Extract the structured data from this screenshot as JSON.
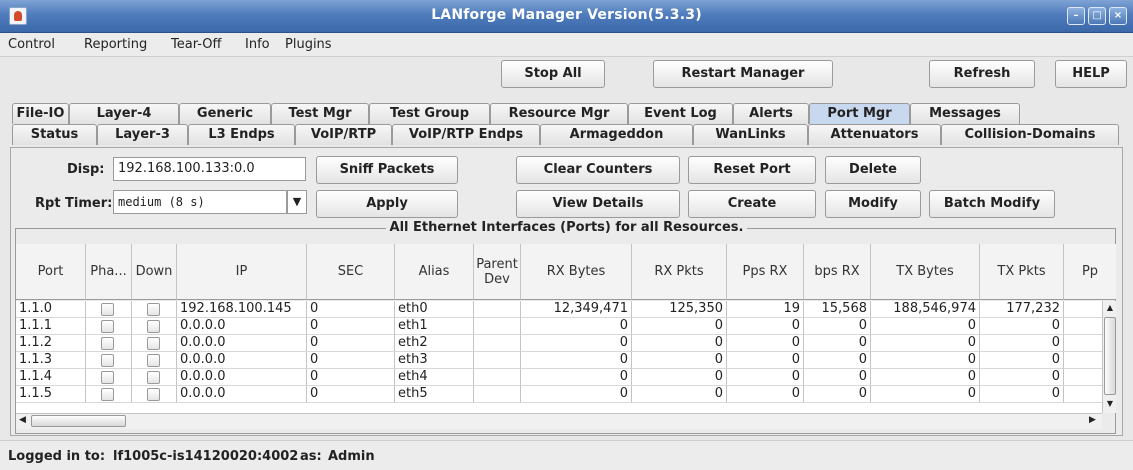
{
  "window": {
    "title": "LANforge Manager   Version(5.3.3)",
    "controls": [
      "minimize-icon",
      "maximize-icon",
      "close-icon"
    ]
  },
  "menu": [
    "Control",
    "Reporting",
    "Tear-Off",
    "Info",
    "Plugins"
  ],
  "toolbar": {
    "stop_all": "Stop All",
    "restart_manager": "Restart Manager",
    "refresh": "Refresh",
    "help": "HELP"
  },
  "tabs_row1": [
    "File-IO",
    "Layer-4",
    "Generic",
    "Test Mgr",
    "Test Group",
    "Resource Mgr",
    "Event Log",
    "Alerts",
    "Port Mgr",
    "Messages"
  ],
  "tabs_row2": [
    "Status",
    "Layer-3",
    "L3 Endps",
    "VoIP/RTP",
    "VoIP/RTP Endps",
    "Armageddon",
    "WanLinks",
    "Attenuators",
    "Collision-Domains"
  ],
  "active_tab": "Port Mgr",
  "controls": {
    "disp_label": "Disp:",
    "disp_value": "192.168.100.133:0.0",
    "rpt_timer_label": "Rpt Timer:",
    "rpt_timer_value": "medium   (8 s)",
    "sniff_packets": "Sniff Packets",
    "apply": "Apply",
    "clear_counters": "Clear Counters",
    "reset_port": "Reset Port",
    "delete": "Delete",
    "view_details": "View Details",
    "create": "Create",
    "modify": "Modify",
    "batch_modify": "Batch Modify"
  },
  "table": {
    "title": "All Ethernet Interfaces (Ports) for all Resources.",
    "headers": [
      "Port",
      "Pha...",
      "Down",
      "IP",
      "SEC",
      "Alias",
      "Parent Dev",
      "RX Bytes",
      "RX Pkts",
      "Pps RX",
      "bps RX",
      "TX Bytes",
      "TX Pkts",
      "Pp"
    ],
    "rows": [
      {
        "port": "1.1.0",
        "ip": "192.168.100.145",
        "sec": "0",
        "alias": "eth0",
        "parent": "",
        "rx_bytes": "12,349,471",
        "rx_pkts": "125,350",
        "pps_rx": "19",
        "bps_rx": "15,568",
        "tx_bytes": "188,546,974",
        "tx_pkts": "177,232"
      },
      {
        "port": "1.1.1",
        "ip": "0.0.0.0",
        "sec": "0",
        "alias": "eth1",
        "parent": "",
        "rx_bytes": "0",
        "rx_pkts": "0",
        "pps_rx": "0",
        "bps_rx": "0",
        "tx_bytes": "0",
        "tx_pkts": "0"
      },
      {
        "port": "1.1.2",
        "ip": "0.0.0.0",
        "sec": "0",
        "alias": "eth2",
        "parent": "",
        "rx_bytes": "0",
        "rx_pkts": "0",
        "pps_rx": "0",
        "bps_rx": "0",
        "tx_bytes": "0",
        "tx_pkts": "0"
      },
      {
        "port": "1.1.3",
        "ip": "0.0.0.0",
        "sec": "0",
        "alias": "eth3",
        "parent": "",
        "rx_bytes": "0",
        "rx_pkts": "0",
        "pps_rx": "0",
        "bps_rx": "0",
        "tx_bytes": "0",
        "tx_pkts": "0"
      },
      {
        "port": "1.1.4",
        "ip": "0.0.0.0",
        "sec": "0",
        "alias": "eth4",
        "parent": "",
        "rx_bytes": "0",
        "rx_pkts": "0",
        "pps_rx": "0",
        "bps_rx": "0",
        "tx_bytes": "0",
        "tx_pkts": "0"
      },
      {
        "port": "1.1.5",
        "ip": "0.0.0.0",
        "sec": "0",
        "alias": "eth5",
        "parent": "",
        "rx_bytes": "0",
        "rx_pkts": "0",
        "pps_rx": "0",
        "bps_rx": "0",
        "tx_bytes": "0",
        "tx_pkts": "0"
      }
    ]
  },
  "status": {
    "logged_in_to_label": "Logged in to:",
    "host": "lf1005c-is14120020:4002",
    "as_label": "as:",
    "user": "Admin"
  },
  "colors": {
    "titlebar": "#4f7cbd",
    "active_tab": "#c8d8ee",
    "background": "#e8e8e8"
  }
}
